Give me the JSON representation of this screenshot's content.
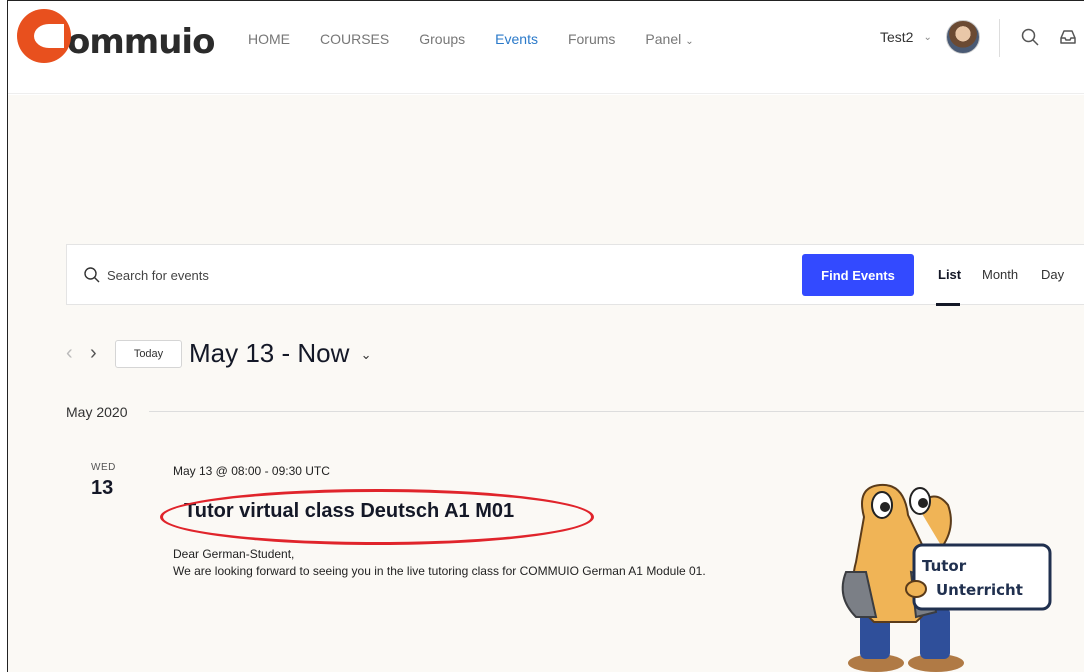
{
  "brand": {
    "logo_text": "ommuio",
    "logo_letter": "C"
  },
  "nav": {
    "items": [
      {
        "label": "HOME",
        "active": false
      },
      {
        "label": "COURSES",
        "active": false
      },
      {
        "label": "Groups",
        "active": false
      },
      {
        "label": "Events",
        "active": true
      },
      {
        "label": "Forums",
        "active": false
      },
      {
        "label": "Panel",
        "active": false,
        "has_dropdown": true
      }
    ]
  },
  "user": {
    "name": "Test2"
  },
  "search": {
    "placeholder": "Search for events",
    "button_label": "Find Events"
  },
  "views": {
    "list": "List",
    "month": "Month",
    "day": "Day",
    "selected": "List"
  },
  "date_nav": {
    "today_label": "Today",
    "range_label": "May 13 - Now"
  },
  "month_separator": "May 2020",
  "event": {
    "weekday": "WED",
    "day": "13",
    "time": "May 13 @ 08:00 - 09:30 UTC",
    "title": "Tutor virtual class Deutsch A1 M01",
    "description_line1": "Dear German-Student,",
    "description_line2": "We are looking forward to seeing you in the live tutoring class for COMMUIO German A1 Module 01.",
    "image_sign_text": [
      "Tutor",
      "Unterricht"
    ]
  },
  "colors": {
    "accent_blue": "#334aff",
    "nav_active": "#2a79c9",
    "logo_orange": "#e8501e",
    "annotation_red": "#e0242b"
  }
}
